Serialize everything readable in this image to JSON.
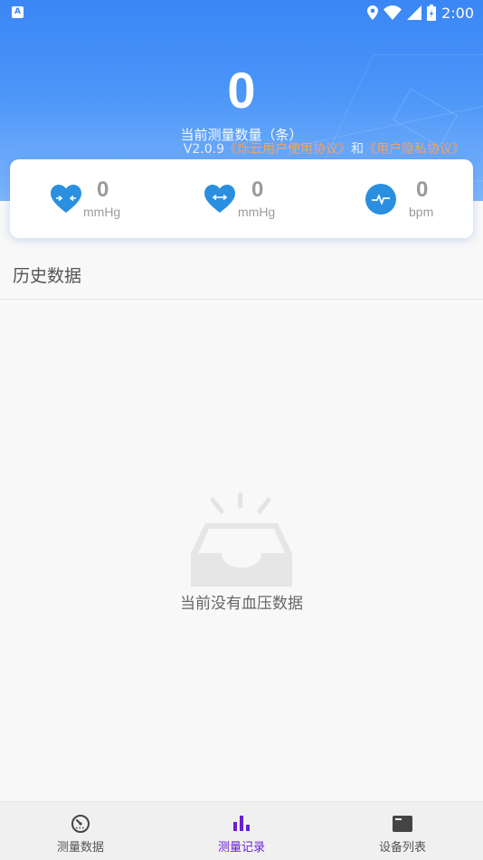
{
  "status_bar": {
    "time": "2:00",
    "notification_glyph": "A"
  },
  "header": {
    "count": "0",
    "count_label": "当前测量数量（条）",
    "version": "V2.0.9",
    "user_agreement": "《烁云用户使用协议》",
    "and": "和",
    "privacy_agreement": "《用户隐私协议》"
  },
  "metrics": [
    {
      "icon": "heart-pressure-in-icon",
      "value": "0",
      "unit": "mmHg"
    },
    {
      "icon": "heart-pressure-out-icon",
      "value": "0",
      "unit": "mmHg"
    },
    {
      "icon": "pulse-icon",
      "value": "0",
      "unit": "bpm"
    }
  ],
  "history": {
    "title": "历史数据",
    "empty_text": "当前没有血压数据"
  },
  "bottom_nav": {
    "items": [
      {
        "label": "测量数据",
        "icon": "gauge-icon",
        "active": false
      },
      {
        "label": "测量记录",
        "icon": "bar-chart-icon",
        "active": true
      },
      {
        "label": "设备列表",
        "icon": "device-list-icon",
        "active": false
      }
    ]
  },
  "colors": {
    "accent": "#3a86f5",
    "active_nav": "#6a1fd1",
    "link": "#f4a261",
    "heart": "#2a8fe0"
  }
}
